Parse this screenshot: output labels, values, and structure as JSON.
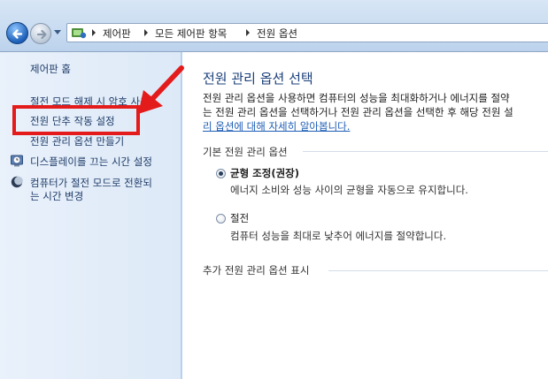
{
  "address": {
    "crumbs": [
      "제어판",
      "모든 제어판 항목",
      "전원 옵션"
    ]
  },
  "sidebar": {
    "home": "제어판 홈",
    "items": [
      {
        "label": "절전 모드 해제 시 암호 사용"
      },
      {
        "label": "전원 단추 작동 설정"
      },
      {
        "label": "전원 관리 옵션 만들기"
      },
      {
        "label": "디스플레이를 끄는 시간 설정",
        "icon": "clock-icon"
      },
      {
        "label_line1": "컴퓨터가 절전 모드로 전환되",
        "label_line2": "는 시간 변경",
        "icon": "moon-icon"
      }
    ]
  },
  "main": {
    "title": "전원 관리 옵션 선택",
    "intro_line1": "전원 관리 옵션을 사용하면 컴퓨터의 성능을 최대화하거나 에너지를 절약",
    "intro_line2": "는 전원 관리 옵션을 선택하거나 전원 관리 옵션을 선택한 후 해당 전원 설",
    "intro_link": "리 옵션에 대해 자세히 알아봅니다.",
    "group_basic": "기본 전원 관리 옵션",
    "plans": [
      {
        "name": "균형 조정(권장)",
        "desc": "에너지 소비와 성능 사이의 균형을 자동으로 유지합니다.",
        "selected": true
      },
      {
        "name": "절전",
        "desc": "컴퓨터 성능을 최대로 낮추어 에너지를 절약합니다.",
        "selected": false
      }
    ],
    "group_more": "추가 전원 관리 옵션 표시"
  },
  "colors": {
    "highlight": "#e31b1b",
    "link": "#1f5eb5",
    "title": "#1a3f7a",
    "sidebar_bg": "#dde9f7"
  }
}
